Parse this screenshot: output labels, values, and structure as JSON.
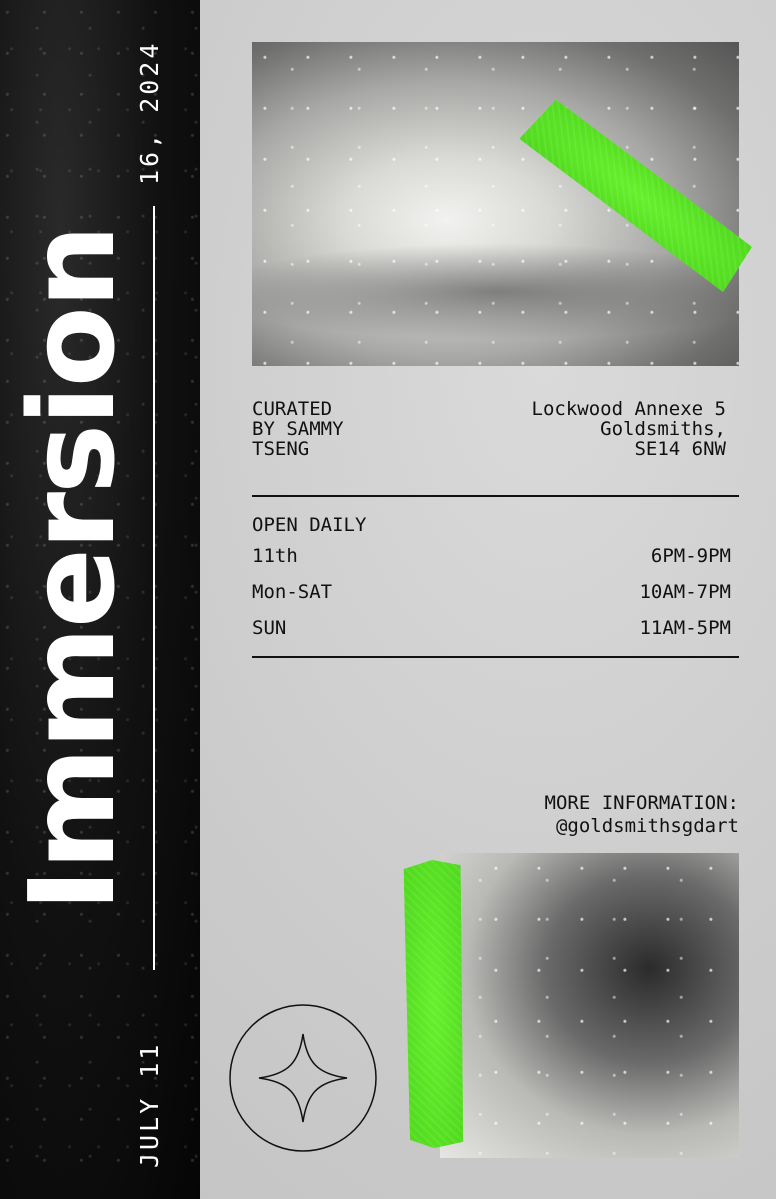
{
  "event": {
    "title": "Immersion",
    "date_start": "JULY 11",
    "date_end": "16, 2024"
  },
  "curator": {
    "lines": [
      "CURATED",
      "BY SAMMY",
      "TSENG"
    ]
  },
  "venue": {
    "lines": [
      "Lockwood Annexe 5",
      "Goldsmiths,",
      "SE14 6NW"
    ]
  },
  "hours": {
    "heading": "OPEN DAILY",
    "rows": [
      {
        "day": "11th",
        "time": "6PM-9PM"
      },
      {
        "day": "Mon-SAT",
        "time": "10AM-7PM"
      },
      {
        "day": "SUN",
        "time": "11AM-5PM"
      }
    ]
  },
  "more_info": {
    "label": "MORE INFORMATION:",
    "handle": "@goldsmithsgdart"
  },
  "colors": {
    "accent": "#5bea24",
    "band": "#0d0d0d",
    "background": "#cfcfcf",
    "text": "#111111"
  },
  "icons": {
    "badge": "four-point-star-icon"
  }
}
